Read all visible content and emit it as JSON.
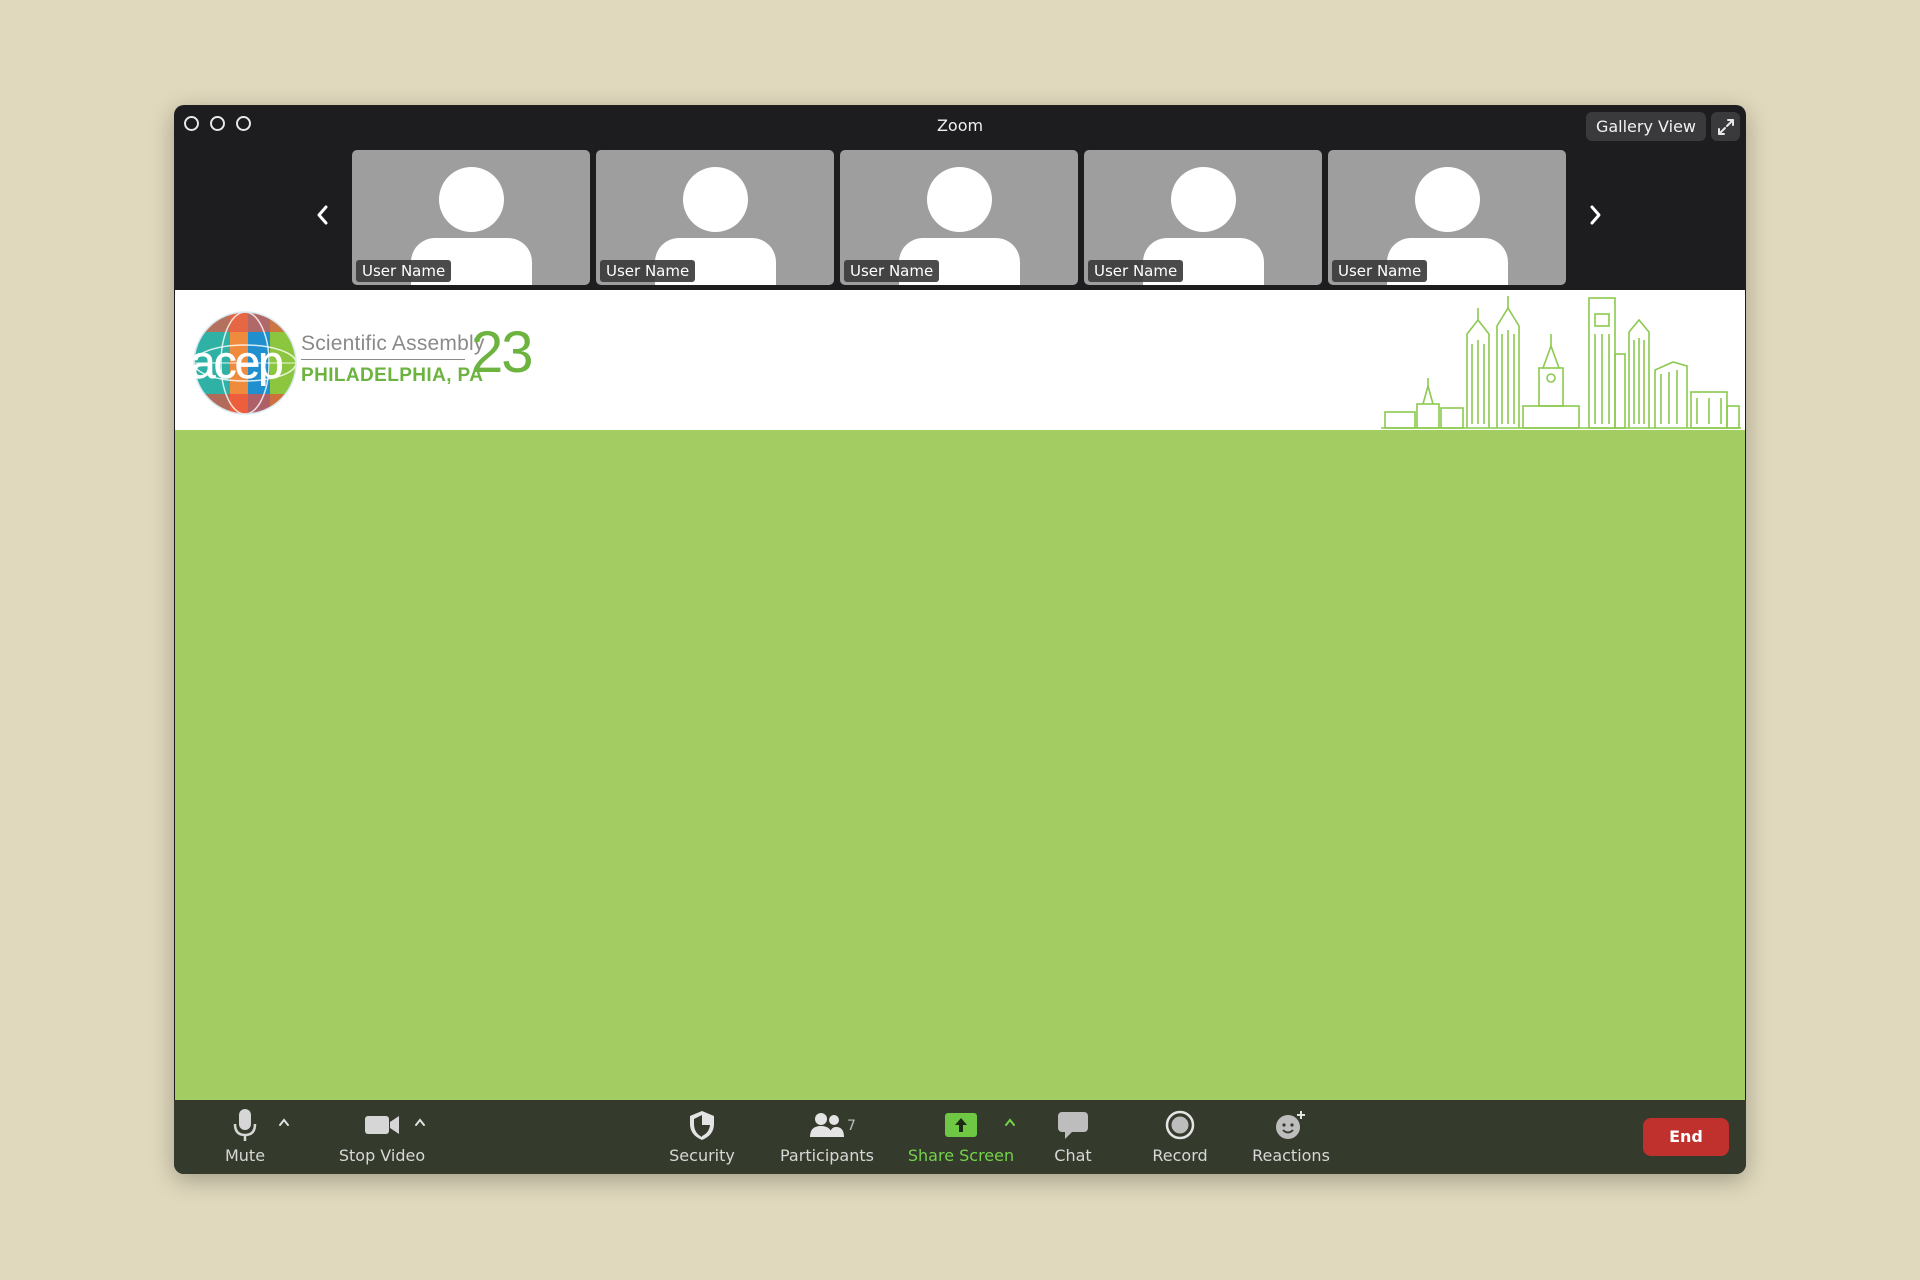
{
  "window": {
    "title": "Zoom",
    "gallery_view_label": "Gallery View"
  },
  "thumbnails": [
    {
      "user_name": "User Name"
    },
    {
      "user_name": "User Name"
    },
    {
      "user_name": "User Name"
    },
    {
      "user_name": "User Name"
    },
    {
      "user_name": "User Name"
    }
  ],
  "banner": {
    "logo_word": "acep",
    "subtitle": "Scientific Assembly",
    "location": "PHILADELPHIA, PA",
    "year": "23"
  },
  "toolbar": {
    "mute": "Mute",
    "stop_video": "Stop Video",
    "security": "Security",
    "participants": "Participants",
    "participant_count": "7",
    "share_screen": "Share Screen",
    "chat": "Chat",
    "record": "Record",
    "reactions": "Reactions",
    "end": "End"
  },
  "colors": {
    "background": "#e0d9bd",
    "stage": "#a3cd62",
    "toolbar": "#353b2c",
    "accent_green": "#6cb33f",
    "end_red": "#c0302d"
  }
}
